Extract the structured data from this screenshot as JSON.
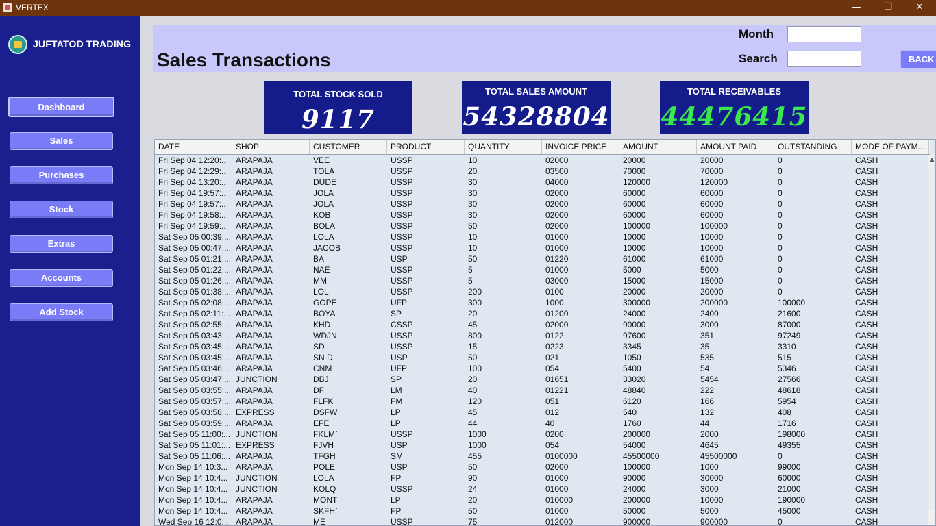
{
  "window": {
    "title": "VERTEX",
    "minimize_glyph": "—",
    "restore_glyph": "❐",
    "close_glyph": "✕"
  },
  "sidebar": {
    "brand": "JUFTATOD TRADING",
    "items": [
      {
        "label": "Dashboard"
      },
      {
        "label": "Sales"
      },
      {
        "label": "Purchases"
      },
      {
        "label": "Stock"
      },
      {
        "label": "Extras"
      },
      {
        "label": "Accounts"
      },
      {
        "label": "Add Stock"
      }
    ]
  },
  "header": {
    "title": "Sales Transactions",
    "month_label": "Month",
    "month_value": "",
    "search_label": "Search",
    "search_value": "",
    "back_label": "BACK"
  },
  "stats": {
    "stock_sold": {
      "label": "TOTAL STOCK SOLD",
      "value": "9117"
    },
    "sales_amount": {
      "label": "TOTAL SALES AMOUNT",
      "value": "54328804"
    },
    "receivables": {
      "label": "TOTAL RECEIVABLES",
      "value": "44476415"
    }
  },
  "colors": {
    "sidebar": "#1a1f8e",
    "card": "#141c8c",
    "receivables_value": "#39e84a",
    "button": "#7a7cf7",
    "header": "#c9c8fb",
    "titlebar": "#6e340d"
  },
  "table": {
    "columns": [
      "DATE",
      "SHOP",
      "CUSTOMER",
      "PRODUCT",
      "QUANTITY",
      "INVOICE PRICE",
      "AMOUNT",
      "AMOUNT PAID",
      "OUTSTANDING",
      "MODE OF PAYM..."
    ],
    "rows": [
      [
        "Fri Sep 04 12:20:...",
        "ARAPAJA",
        "VEE",
        "USSP",
        "10",
        "02000",
        "20000",
        "20000",
        "0",
        "CASH"
      ],
      [
        "Fri Sep 04 12:29:...",
        "ARAPAJA",
        "TOLA",
        "USSP",
        "20",
        "03500",
        "70000",
        "70000",
        "0",
        "CASH"
      ],
      [
        "Fri Sep 04 13:20:...",
        "ARAPAJA",
        "DUDE",
        "USSP",
        "30",
        "04000",
        "120000",
        "120000",
        "0",
        "CASH"
      ],
      [
        "Fri Sep 04 19:57:...",
        "ARAPAJA",
        "JOLA",
        "USSP",
        "30",
        "02000",
        "60000",
        "60000",
        "0",
        "CASH"
      ],
      [
        "Fri Sep 04 19:57:...",
        "ARAPAJA",
        "JOLA",
        "USSP",
        "30",
        "02000",
        "60000",
        "60000",
        "0",
        "CASH"
      ],
      [
        "Fri Sep 04 19:58:...",
        "ARAPAJA",
        "KOB",
        "USSP",
        "30",
        "02000",
        "60000",
        "60000",
        "0",
        "CASH"
      ],
      [
        "Fri Sep 04 19:59:...",
        "ARAPAJA",
        "BOLA",
        "USSP",
        "50",
        "02000",
        "100000",
        "100000",
        "0",
        "CASH"
      ],
      [
        "Sat Sep 05 00:39:...",
        "ARAPAJA",
        "LOLA",
        "USSP",
        "10",
        "01000",
        "10000",
        "10000",
        "0",
        "CASH"
      ],
      [
        "Sat Sep 05 00:47:...",
        "ARAPAJA",
        "JACOB",
        "USSP",
        "10",
        "01000",
        "10000",
        "10000",
        "0",
        "CASH"
      ],
      [
        "Sat Sep 05 01:21:...",
        "ARAPAJA",
        "BA",
        "USP",
        "50",
        "01220",
        "61000",
        "61000",
        "0",
        "CASH"
      ],
      [
        "Sat Sep 05 01:22:...",
        "ARAPAJA",
        "NAE",
        "USSP",
        "5",
        "01000",
        "5000",
        "5000",
        "0",
        "CASH"
      ],
      [
        "Sat Sep 05 01:26:...",
        "ARAPAJA",
        "MM",
        "USSP",
        "5",
        "03000",
        "15000",
        "15000",
        "0",
        "CASH"
      ],
      [
        "Sat Sep 05 01:38:...",
        "ARAPAJA",
        "LOL",
        "USSP",
        "200",
        "0100",
        "20000",
        "20000",
        "0",
        "CASH"
      ],
      [
        "Sat Sep 05 02:08:...",
        "ARAPAJA",
        "GOPE",
        "UFP",
        "300",
        "1000",
        "300000",
        "200000",
        "100000",
        "CASH"
      ],
      [
        "Sat Sep 05 02:11:...",
        "ARAPAJA",
        "BOYA",
        "SP",
        "20",
        "01200",
        "24000",
        "2400",
        "21600",
        "CASH"
      ],
      [
        "Sat Sep 05 02:55:...",
        "ARAPAJA",
        "KHD",
        "CSSP",
        "45",
        "02000",
        "90000",
        "3000",
        "87000",
        "CASH"
      ],
      [
        "Sat Sep 05 03:43:...",
        "ARAPAJA",
        "WDJN",
        "USSP",
        "800",
        "0122",
        "97600",
        "351",
        "97249",
        "CASH"
      ],
      [
        "Sat Sep 05 03:45:...",
        "ARAPAJA",
        "SD",
        "USSP",
        "15",
        "0223",
        "3345",
        "35",
        "3310",
        "CASH"
      ],
      [
        "Sat Sep 05 03:45:...",
        "ARAPAJA",
        "SN D",
        "USP",
        "50",
        "021",
        "1050",
        "535",
        "515",
        "CASH"
      ],
      [
        "Sat Sep 05 03:46:...",
        "ARAPAJA",
        "CNM",
        "UFP",
        "100",
        "054",
        "5400",
        "54",
        "5346",
        "CASH"
      ],
      [
        "Sat Sep 05 03:47:...",
        "JUNCTION",
        "DBJ",
        "SP",
        "20",
        "01651",
        "33020",
        "5454",
        "27566",
        "CASH"
      ],
      [
        "Sat Sep 05 03:55:...",
        "ARAPAJA",
        "DF",
        "LM",
        "40",
        "01221",
        "48840",
        "222",
        "48618",
        "CASH"
      ],
      [
        "Sat Sep 05 03:57:...",
        "ARAPAJA",
        "FLFK",
        "FM",
        "120",
        "051",
        "6120",
        "166",
        "5954",
        "CASH"
      ],
      [
        "Sat Sep 05 03:58:...",
        "EXPRESS",
        "DSFW",
        "LP",
        "45",
        "012",
        "540",
        "132",
        "408",
        "CASH"
      ],
      [
        "Sat Sep 05 03:59:...",
        "ARAPAJA",
        "EFE",
        "LP",
        "44",
        "40",
        "1760",
        "44",
        "1716",
        "CASH"
      ],
      [
        "Sat Sep 05 11:00:...",
        "JUNCTION",
        "FKLM`",
        "USSP",
        "1000",
        "0200",
        "200000",
        "2000",
        "198000",
        "CASH"
      ],
      [
        "Sat Sep 05 11:01:...",
        "EXPRESS",
        "FJVH",
        "USP",
        "1000",
        "054",
        "54000",
        "4645",
        "49355",
        "CASH"
      ],
      [
        "Sat Sep 05 11:06:...",
        "ARAPAJA",
        "TFGH",
        "SM",
        "455",
        "0100000",
        "45500000",
        "45500000",
        "0",
        "CASH"
      ],
      [
        "Mon Sep 14 10:3...",
        "ARAPAJA",
        "POLE",
        "USP",
        "50",
        "02000",
        "100000",
        "1000",
        "99000",
        "CASH"
      ],
      [
        "Mon Sep 14 10:4...",
        "JUNCTION",
        "LOLA",
        "FP",
        "90",
        "01000",
        "90000",
        "30000",
        "60000",
        "CASH"
      ],
      [
        "Mon Sep 14 10:4...",
        "JUNCTION",
        "KOLQ",
        "USSP",
        "24",
        "01000",
        "24000",
        "3000",
        "21000",
        "CASH"
      ],
      [
        "Mon Sep 14 10:4...",
        "ARAPAJA",
        "MONT",
        "LP",
        "20",
        "010000",
        "200000",
        "10000",
        "190000",
        "CASH"
      ],
      [
        "Mon Sep 14 10:4...",
        "ARAPAJA",
        "SKFH`",
        "FP",
        "50",
        "01000",
        "50000",
        "5000",
        "45000",
        "CASH"
      ],
      [
        "Wed Sep 16 12:0...",
        "ARAPAJA",
        "ME",
        "USSP",
        "75",
        "012000",
        "900000",
        "900000",
        "0",
        "CASH"
      ]
    ]
  }
}
